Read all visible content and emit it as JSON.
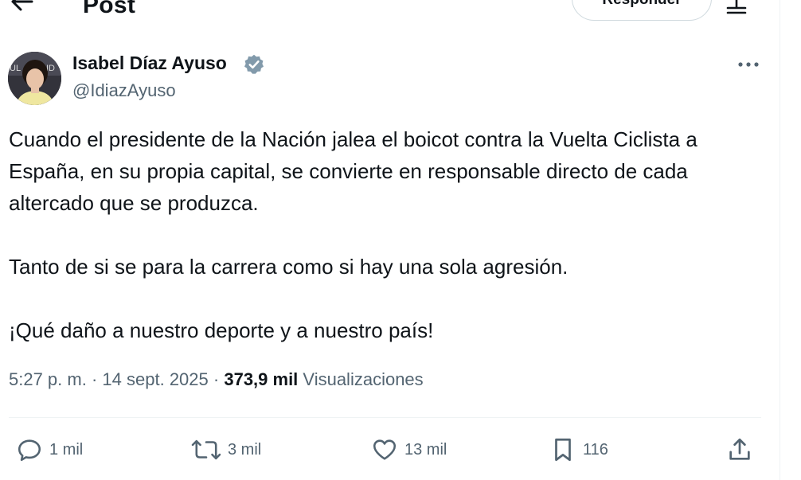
{
  "header": {
    "title": "Post",
    "reply_button_label": "Responder",
    "back_icon": "arrow-left-icon",
    "layout_icon": "layout-icon"
  },
  "author": {
    "name": "Isabel Díaz Ayuso",
    "handle": "@IdiazAyuso",
    "verified": true,
    "verified_color": "#829aab"
  },
  "tweet": {
    "paragraphs": [
      "Cuando el presidente de la Nación jalea el boicot contra la Vuelta Ciclista a España, en su propia capital, se convierte en responsable directo de cada altercado que se produzca.",
      "Tanto de si se para la carrera como si hay una sola agresión.",
      "¡Qué daño a nuestro deporte y a nuestro país!"
    ]
  },
  "meta": {
    "time": "5:27 p. m.",
    "separator": "·",
    "date": "14 sept. 2025",
    "views_count": "373,9 mil",
    "views_label": "Visualizaciones"
  },
  "actions": {
    "replies": "1 mil",
    "retweets": "3 mil",
    "likes": "13 mil",
    "bookmarks": "116"
  },
  "colors": {
    "text_primary": "#0f1419",
    "text_secondary": "#536471",
    "border": "#eff3f4"
  }
}
